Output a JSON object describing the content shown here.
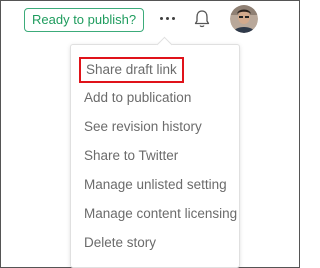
{
  "header": {
    "publish_label": "Ready to publish?",
    "more_icon": "more-horizontal-icon",
    "bell_icon": "bell-icon",
    "avatar": "user-avatar"
  },
  "menu": {
    "items": [
      {
        "label": "Share draft link",
        "highlighted": true
      },
      {
        "label": "Add to publication"
      },
      {
        "label": "See revision history"
      },
      {
        "label": "Share to Twitter"
      },
      {
        "label": "Manage unlisted setting"
      },
      {
        "label": "Manage content licensing"
      },
      {
        "label": "Delete story"
      }
    ]
  },
  "colors": {
    "publish_green": "#1f9c5e",
    "highlight_red": "#e0131a",
    "menu_text": "#6b6b6b"
  }
}
